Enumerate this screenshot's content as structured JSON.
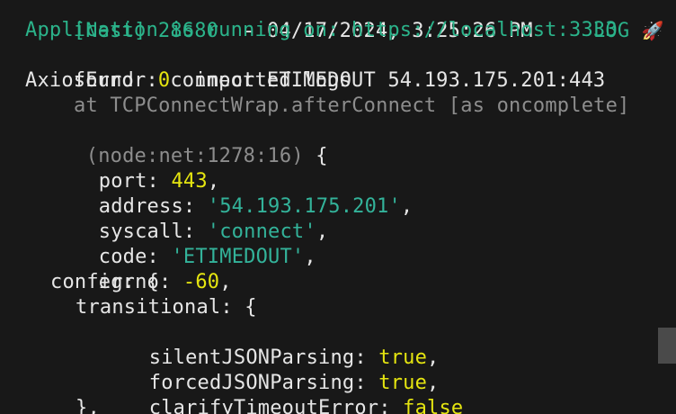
{
  "terminal": {
    "header": {
      "nest": "[Nest]",
      "pid": "28680",
      "dash": "-",
      "timestamp": "04/17/2024, 3:25:26 PM",
      "level": "LOG",
      "rocket": "🚀"
    },
    "app_running": "Application is running on: https://localhost:3333",
    "found": {
      "word1": "found",
      "count": "0",
      "word2": "imported logs"
    },
    "axios_error": "AxiosError: connect ETIMEDOUT 54.193.175.201:443",
    "stack_line": "at TCPConnectWrap.afterConnect [as oncomplete]",
    "node_ref": "(node:net:1278:16)",
    "open_brace": "{",
    "fields": {
      "port_key": "port:",
      "port_val": "443",
      "address_key": "address:",
      "address_val": "'54.193.175.201'",
      "syscall_key": "syscall:",
      "syscall_val": "'connect'",
      "code_key": "code:",
      "code_val": "'ETIMEDOUT'",
      "errno_key": "errno:",
      "errno_val": "-60",
      "config_key": "config: {",
      "transitional_key": "transitional: {",
      "silent_key": "silentJSONParsing:",
      "silent_val": "true",
      "forced_key": "forcedJSONParsing:",
      "forced_val": "true",
      "clarify_key": "clarifyTimeoutError:",
      "clarify_val": "false",
      "close_brace": "},"
    },
    "comma": ","
  }
}
